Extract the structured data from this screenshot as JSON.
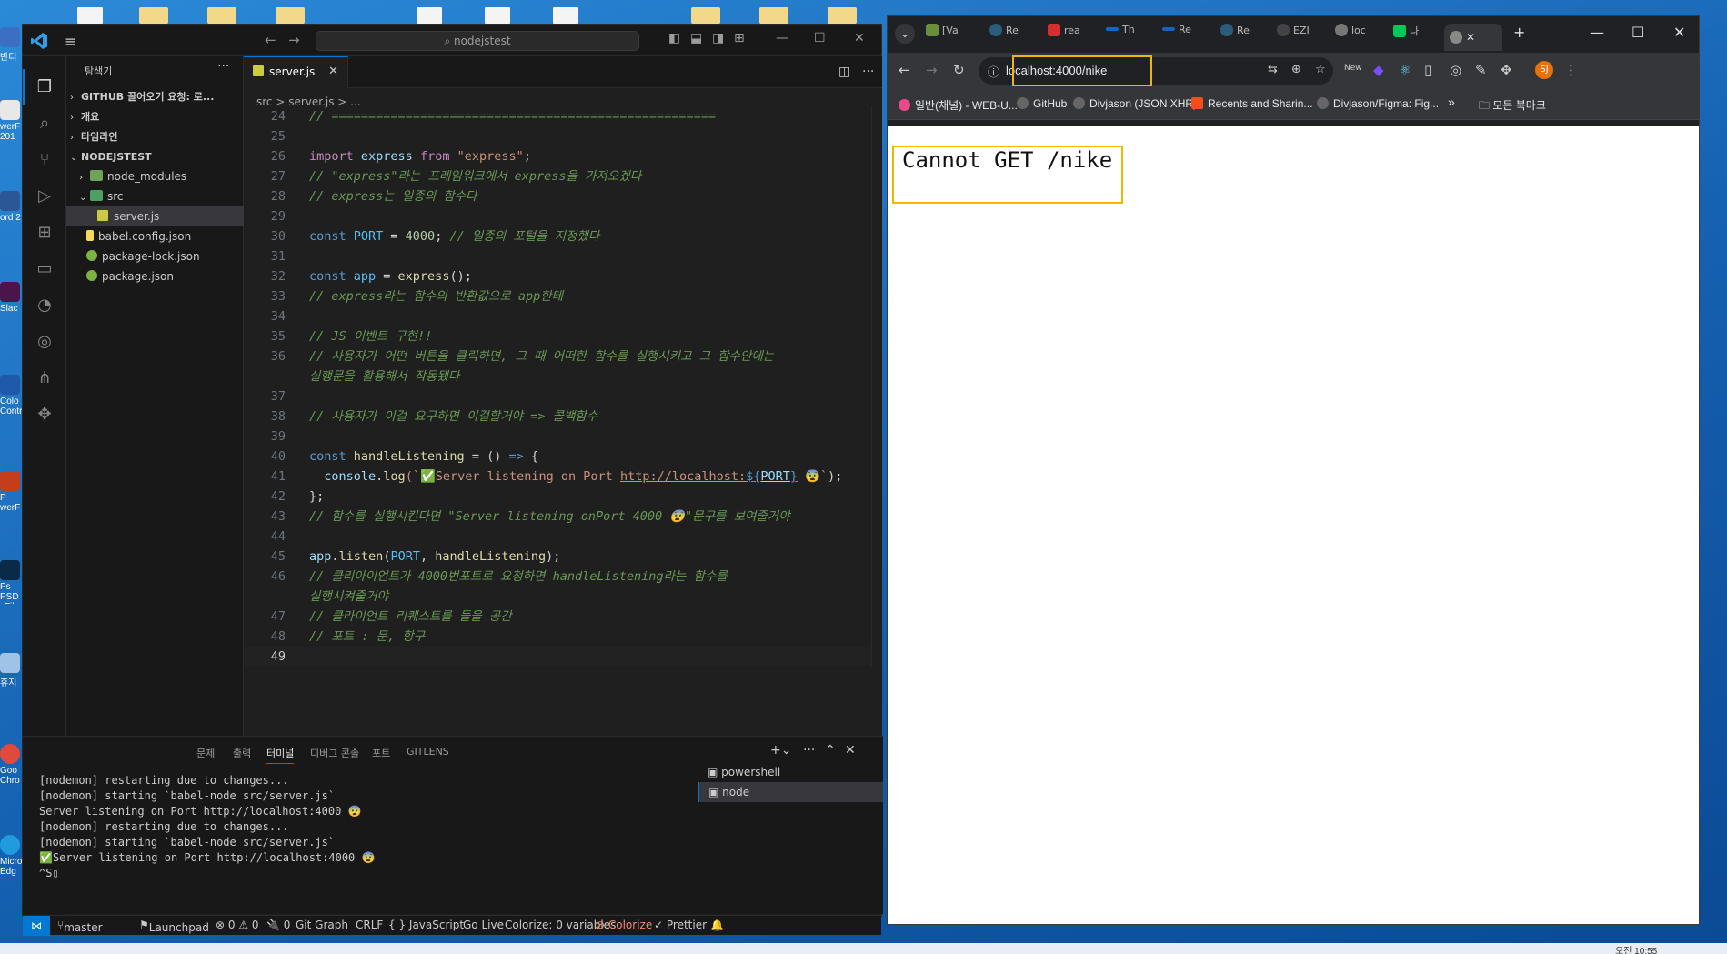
{
  "desktop": {
    "icons": [
      "반디",
      "werF 201",
      "ord 2",
      "Slac",
      "Colo Contr",
      "P werF",
      "Ps PSD xFile",
      "휴지",
      "Goo Chro",
      "Micro Edg"
    ]
  },
  "vscode": {
    "search": "nodejstest",
    "explorer_title": "탐색기",
    "tree": [
      {
        "label": "GITHUB 끌어오기 요청: 로...",
        "kind": "section"
      },
      {
        "label": "개요",
        "kind": "section"
      },
      {
        "label": "타임라인",
        "kind": "section"
      },
      {
        "label": "NODEJSTEST",
        "kind": "root"
      },
      {
        "label": "node_modules",
        "kind": "folder"
      },
      {
        "label": "src",
        "kind": "folder-open"
      },
      {
        "label": "server.js",
        "kind": "js"
      },
      {
        "label": "babel.config.json",
        "kind": "babel"
      },
      {
        "label": "package-lock.json",
        "kind": "json"
      },
      {
        "label": "package.json",
        "kind": "json"
      }
    ],
    "tab": "server.js",
    "breadcrumb": "src > server.js > ...",
    "lines": {
      "24": "24",
      "25": "25",
      "26": "26",
      "27": "27",
      "28": "28",
      "29": "29",
      "30": "30",
      "31": "31",
      "32": "32",
      "33": "33",
      "34": "34",
      "35": "35",
      "36": "36",
      "37": "37",
      "38": "38",
      "39": "39",
      "40": "40",
      "41": "41",
      "42": "42",
      "43": "43",
      "44": "44",
      "45": "45",
      "46": "46",
      "47": "47",
      "48": "48",
      "49": "49"
    },
    "code": {
      "l24": "// ====================================================",
      "l26a": "import",
      "l26b": " express ",
      "l26c": "from",
      "l26d": " \"express\"",
      "l26e": ";",
      "l27": "// \"express\"라는 프레임워크에서 express을 가져오겠다",
      "l28": "// express는 일종의 함수다",
      "l30a": "const",
      "l30b": " PORT",
      "l30c": " = ",
      "l30d": "4000",
      "l30e": "; ",
      "l30f": "// 일종의 포털을 지정했다",
      "l32a": "const",
      "l32b": " app",
      "l32c": " = ",
      "l32d": "express",
      "l32e": "();",
      "l33": "// express라는 함수의 반환값으로 app한테",
      "l35": "// JS 이벤트 구현!!",
      "l36a": "// 사용자가 어떤 버튼을 클릭하면, 그 때 어떠한 함수를 실행시키고 그 함수안에는",
      "l36b": "실행문을 활용해서 작동됐다",
      "l38": "// 사용자가 이걸 요구하면 이걸할거야 => 콜백함수",
      "l40a": "const",
      "l40b": " handleListening",
      "l40c": " = () ",
      "l40d": "=>",
      "l40e": " {",
      "l41a": "  console",
      "l41b": ".",
      "l41c": "log",
      "l41d": "(`✅Server listening on Port ",
      "l41e": "http://localhost:",
      "l41f": "${",
      "l41g": "PORT",
      "l41h": "}",
      "l41i": " 😨`",
      ");": ");",
      "l42": "};",
      "l43": "// 함수를 실행시킨다면 \"Server listening onPort 4000 😨\"문구를 보여줄거야",
      "l45a": "app",
      "l45b": ".",
      "l45c": "listen",
      "l45d": "(",
      "l45e": "PORT",
      "l45f": ", ",
      "l45g": "handleListening",
      "l45h": ");",
      "l46a": "// 클리아이언트가 4000번포트로 요청하면 handleListening라는 함수를",
      "l46b": "실행시켜줄거야",
      "l47": "// 클라이언트 리퀘스트를 들을 공간",
      "l48": "// 포트 : 문, 항구"
    },
    "panel_tabs": [
      "문제",
      "출력",
      "터미널",
      "디버그 콘솔",
      "포트",
      "GITLENS"
    ],
    "terminal": [
      "[nodemon] restarting due to changes...",
      "[nodemon] starting `babel-node src/server.js`",
      "Server listening on Port http://localhost:4000 😨",
      "[nodemon] restarting due to changes...",
      "[nodemon] starting `babel-node src/server.js`",
      "✅Server listening on Port http://localhost:4000 😨",
      "^S▯"
    ],
    "terminal_list": [
      "powershell",
      "node"
    ],
    "status": {
      "branch": "master",
      "launchpad": "Launchpad",
      "problems": "⊗ 0 ⚠ 0",
      "ports": "🔌 0",
      "gitgraph": "Git Graph",
      "eol": "CRLF",
      "lang": "{ } JavaScript",
      "golive": "Go Live",
      "colorize_vars": "Colorize: 0 variables",
      "colorize": "⊘ Colorize",
      "prettier": "✓ Prettier"
    }
  },
  "browser": {
    "tabs": [
      "[Va",
      "Re",
      "rea",
      "Th",
      "Re",
      "Re",
      "EZI",
      "loc",
      "나"
    ],
    "url": "localhost:4000/nike",
    "bookmarks": [
      "일반(채널) - WEB-U...",
      "GitHub",
      "Divjason (JSON XHR)",
      "Recents and Sharin...",
      "Divjason/Figma: Fig...",
      "모든 북마크"
    ],
    "profile": "SJ",
    "new_badge": "New",
    "page_text": "Cannot GET /nike",
    "highlight_color": "#f5b400"
  },
  "taskbar": {
    "time": "오전 10:55"
  }
}
